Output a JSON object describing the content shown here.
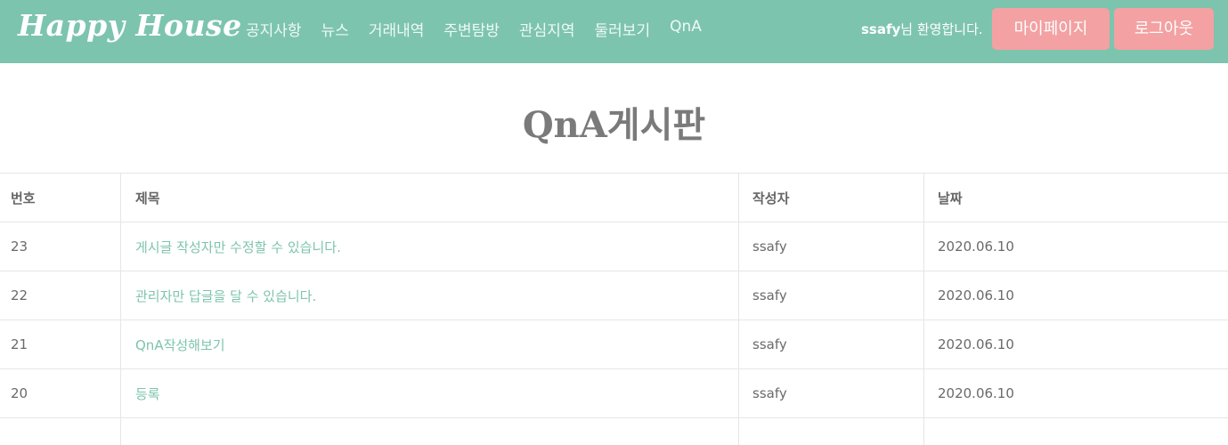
{
  "header": {
    "brand": "Happy House",
    "nav_items": [
      "공지사항",
      "뉴스",
      "거래내역",
      "주변탐방",
      "관심지역",
      "둘러보기",
      "QnA"
    ],
    "welcome_user": "ssafy",
    "welcome_suffix": "님 환영합니다.",
    "mypage_label": "마이페이지",
    "logout_label": "로그아웃",
    "colors": {
      "navbar_bg": "#7dc4ae",
      "button_bg": "#f3a1a2"
    }
  },
  "main": {
    "title": "QnA게시판",
    "table": {
      "columns": [
        "번호",
        "제목",
        "작성자",
        "날짜"
      ],
      "rows": [
        {
          "num": "23",
          "title": "게시글 작성자만 수정할 수 있습니다.",
          "author": "ssafy",
          "date": "2020.06.10"
        },
        {
          "num": "22",
          "title": "관리자만 답글을 달 수 있습니다.",
          "author": "ssafy",
          "date": "2020.06.10"
        },
        {
          "num": "21",
          "title": "QnA작성해보기",
          "author": "ssafy",
          "date": "2020.06.10"
        },
        {
          "num": "20",
          "title": "등록",
          "author": "ssafy",
          "date": "2020.06.10"
        }
      ]
    }
  }
}
